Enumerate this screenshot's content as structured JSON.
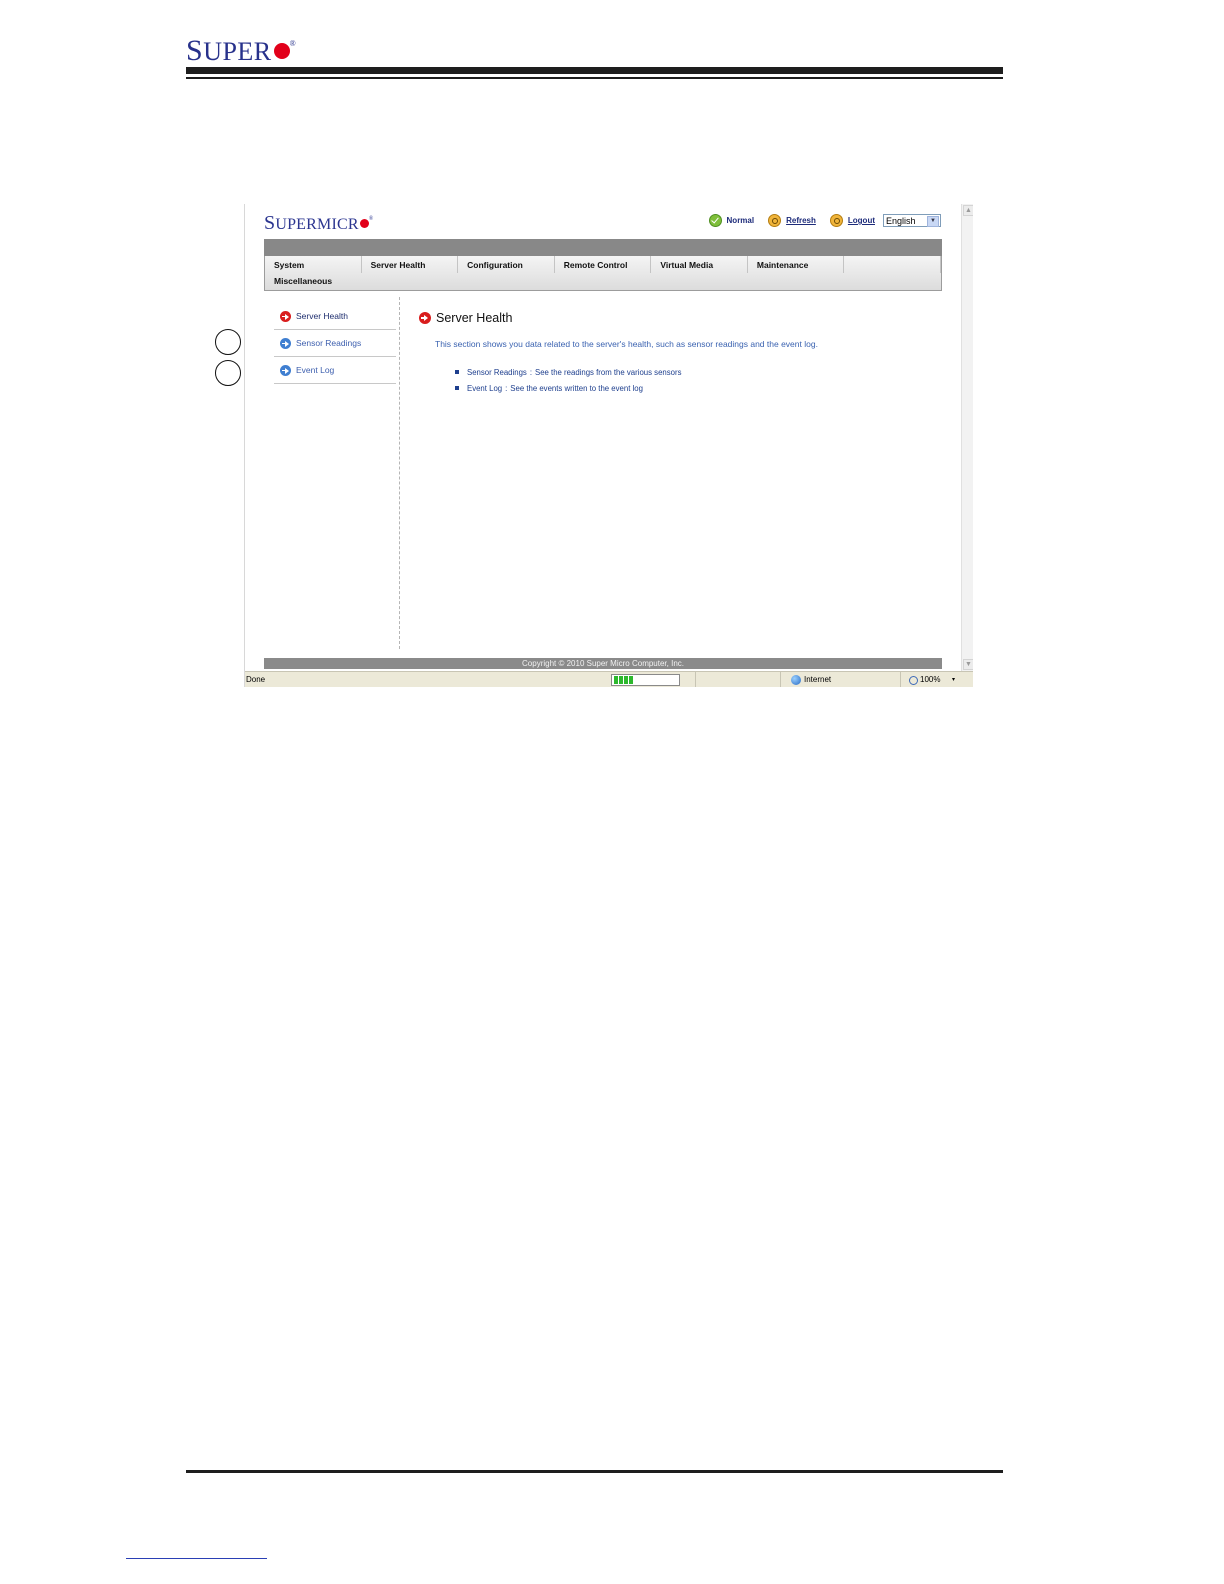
{
  "doc": {
    "logo_first": "S",
    "logo_rest": "UPER",
    "logo_reg": "®"
  },
  "app": {
    "logo_first": "S",
    "logo_rest": "UPERMICR",
    "logo_reg": "®",
    "status": "Normal",
    "refresh": "Refresh",
    "logout": "Logout",
    "language": "English"
  },
  "menu": {
    "items": [
      "System",
      "Server Health",
      "Configuration",
      "Remote Control",
      "Virtual Media",
      "Maintenance",
      "",
      "Miscellaneous"
    ]
  },
  "sidebar": {
    "items": [
      {
        "label": "Server Health",
        "active": true
      },
      {
        "label": "Sensor Readings",
        "active": false
      },
      {
        "label": "Event Log",
        "active": false
      }
    ]
  },
  "content": {
    "title": "Server Health",
    "description": "This section shows you data related to the server's health, such as sensor readings and the event log.",
    "links": [
      {
        "name": "Sensor Readings",
        "sep": ":",
        "text": "See the readings from the various sensors"
      },
      {
        "name": "Event Log",
        "sep": ":",
        "text": "See the events written to the event log"
      }
    ]
  },
  "footer": {
    "copyright": "Copyright © 2010 Super Micro Computer, Inc."
  },
  "browser": {
    "status_text": "Done",
    "progress_blocks": 4,
    "zone": "Internet",
    "zoom": "100%",
    "zoom_caret": "▾",
    "scroll_up": "▲",
    "scroll_down": "▼",
    "lang_caret": "▼"
  }
}
